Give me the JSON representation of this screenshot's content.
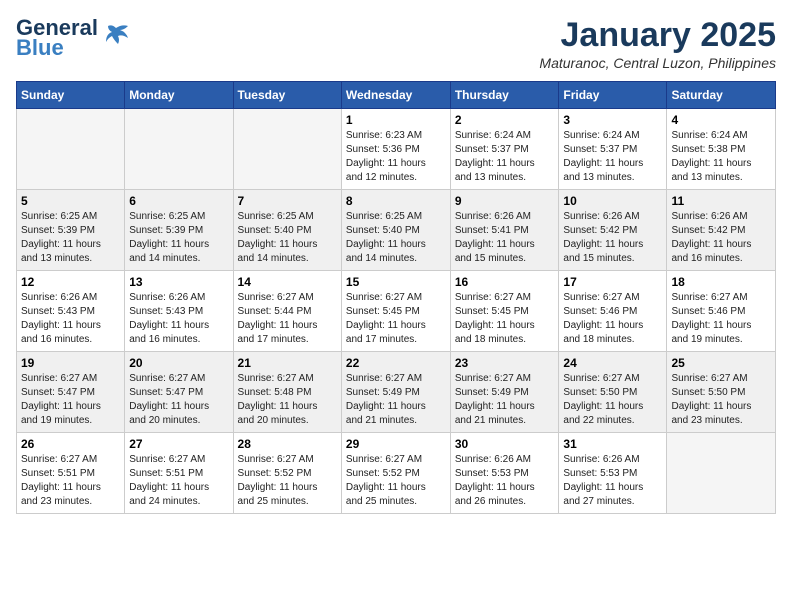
{
  "logo": {
    "line1": "General",
    "line2": "Blue"
  },
  "title": "January 2025",
  "location": "Maturanoc, Central Luzon, Philippines",
  "days_of_week": [
    "Sunday",
    "Monday",
    "Tuesday",
    "Wednesday",
    "Thursday",
    "Friday",
    "Saturday"
  ],
  "weeks": [
    [
      {
        "day": "",
        "info": ""
      },
      {
        "day": "",
        "info": ""
      },
      {
        "day": "",
        "info": ""
      },
      {
        "day": "1",
        "info": "Sunrise: 6:23 AM\nSunset: 5:36 PM\nDaylight: 11 hours\nand 12 minutes."
      },
      {
        "day": "2",
        "info": "Sunrise: 6:24 AM\nSunset: 5:37 PM\nDaylight: 11 hours\nand 13 minutes."
      },
      {
        "day": "3",
        "info": "Sunrise: 6:24 AM\nSunset: 5:37 PM\nDaylight: 11 hours\nand 13 minutes."
      },
      {
        "day": "4",
        "info": "Sunrise: 6:24 AM\nSunset: 5:38 PM\nDaylight: 11 hours\nand 13 minutes."
      }
    ],
    [
      {
        "day": "5",
        "info": "Sunrise: 6:25 AM\nSunset: 5:39 PM\nDaylight: 11 hours\nand 13 minutes."
      },
      {
        "day": "6",
        "info": "Sunrise: 6:25 AM\nSunset: 5:39 PM\nDaylight: 11 hours\nand 14 minutes."
      },
      {
        "day": "7",
        "info": "Sunrise: 6:25 AM\nSunset: 5:40 PM\nDaylight: 11 hours\nand 14 minutes."
      },
      {
        "day": "8",
        "info": "Sunrise: 6:25 AM\nSunset: 5:40 PM\nDaylight: 11 hours\nand 14 minutes."
      },
      {
        "day": "9",
        "info": "Sunrise: 6:26 AM\nSunset: 5:41 PM\nDaylight: 11 hours\nand 15 minutes."
      },
      {
        "day": "10",
        "info": "Sunrise: 6:26 AM\nSunset: 5:42 PM\nDaylight: 11 hours\nand 15 minutes."
      },
      {
        "day": "11",
        "info": "Sunrise: 6:26 AM\nSunset: 5:42 PM\nDaylight: 11 hours\nand 16 minutes."
      }
    ],
    [
      {
        "day": "12",
        "info": "Sunrise: 6:26 AM\nSunset: 5:43 PM\nDaylight: 11 hours\nand 16 minutes."
      },
      {
        "day": "13",
        "info": "Sunrise: 6:26 AM\nSunset: 5:43 PM\nDaylight: 11 hours\nand 16 minutes."
      },
      {
        "day": "14",
        "info": "Sunrise: 6:27 AM\nSunset: 5:44 PM\nDaylight: 11 hours\nand 17 minutes."
      },
      {
        "day": "15",
        "info": "Sunrise: 6:27 AM\nSunset: 5:45 PM\nDaylight: 11 hours\nand 17 minutes."
      },
      {
        "day": "16",
        "info": "Sunrise: 6:27 AM\nSunset: 5:45 PM\nDaylight: 11 hours\nand 18 minutes."
      },
      {
        "day": "17",
        "info": "Sunrise: 6:27 AM\nSunset: 5:46 PM\nDaylight: 11 hours\nand 18 minutes."
      },
      {
        "day": "18",
        "info": "Sunrise: 6:27 AM\nSunset: 5:46 PM\nDaylight: 11 hours\nand 19 minutes."
      }
    ],
    [
      {
        "day": "19",
        "info": "Sunrise: 6:27 AM\nSunset: 5:47 PM\nDaylight: 11 hours\nand 19 minutes."
      },
      {
        "day": "20",
        "info": "Sunrise: 6:27 AM\nSunset: 5:47 PM\nDaylight: 11 hours\nand 20 minutes."
      },
      {
        "day": "21",
        "info": "Sunrise: 6:27 AM\nSunset: 5:48 PM\nDaylight: 11 hours\nand 20 minutes."
      },
      {
        "day": "22",
        "info": "Sunrise: 6:27 AM\nSunset: 5:49 PM\nDaylight: 11 hours\nand 21 minutes."
      },
      {
        "day": "23",
        "info": "Sunrise: 6:27 AM\nSunset: 5:49 PM\nDaylight: 11 hours\nand 21 minutes."
      },
      {
        "day": "24",
        "info": "Sunrise: 6:27 AM\nSunset: 5:50 PM\nDaylight: 11 hours\nand 22 minutes."
      },
      {
        "day": "25",
        "info": "Sunrise: 6:27 AM\nSunset: 5:50 PM\nDaylight: 11 hours\nand 23 minutes."
      }
    ],
    [
      {
        "day": "26",
        "info": "Sunrise: 6:27 AM\nSunset: 5:51 PM\nDaylight: 11 hours\nand 23 minutes."
      },
      {
        "day": "27",
        "info": "Sunrise: 6:27 AM\nSunset: 5:51 PM\nDaylight: 11 hours\nand 24 minutes."
      },
      {
        "day": "28",
        "info": "Sunrise: 6:27 AM\nSunset: 5:52 PM\nDaylight: 11 hours\nand 25 minutes."
      },
      {
        "day": "29",
        "info": "Sunrise: 6:27 AM\nSunset: 5:52 PM\nDaylight: 11 hours\nand 25 minutes."
      },
      {
        "day": "30",
        "info": "Sunrise: 6:26 AM\nSunset: 5:53 PM\nDaylight: 11 hours\nand 26 minutes."
      },
      {
        "day": "31",
        "info": "Sunrise: 6:26 AM\nSunset: 5:53 PM\nDaylight: 11 hours\nand 27 minutes."
      },
      {
        "day": "",
        "info": ""
      }
    ]
  ]
}
